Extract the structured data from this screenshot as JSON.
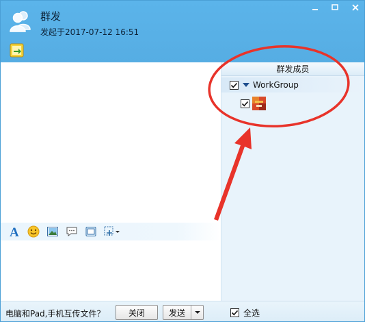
{
  "header": {
    "title": "群发",
    "subtitle": "发起于2017-07-12 16:51"
  },
  "panel": {
    "title": "群发成员",
    "group": {
      "label": "WorkGroup",
      "checked": true
    },
    "members": [
      {
        "checked": true,
        "icon": "member-avatar"
      }
    ]
  },
  "toolbar": {
    "icons": [
      "font-icon",
      "emoji-icon",
      "image-icon",
      "chat-bubble-icon",
      "window-icon",
      "screenshot-icon"
    ]
  },
  "footer": {
    "hint": "电脑和Pad,手机互传文件？",
    "close_label": "关闭",
    "send_label": "发送",
    "select_all_label": "全选"
  },
  "colors": {
    "header": "#56ade3",
    "panel": "#e8f3fb",
    "annotation": "#e8332a"
  }
}
